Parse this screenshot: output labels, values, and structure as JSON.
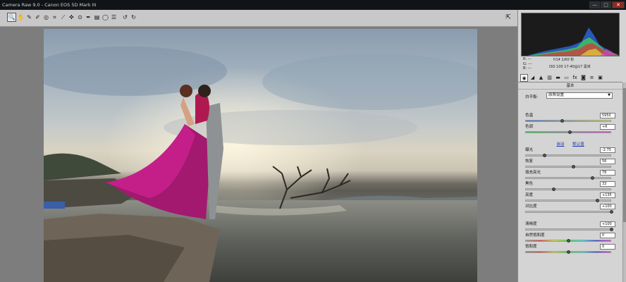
{
  "window": {
    "title": "Camera Raw 9.0 - Canon EOS 5D Mark III",
    "minimize": "—",
    "maximize": "□",
    "close": "✕"
  },
  "toolbar": {
    "tools": [
      {
        "icon": "zoom-tool-icon",
        "glyph": "🔍"
      },
      {
        "icon": "hand-tool-icon",
        "glyph": "✋"
      },
      {
        "icon": "white-balance-tool-icon",
        "glyph": "✎"
      },
      {
        "icon": "color-sampler-tool-icon",
        "glyph": "✐"
      },
      {
        "icon": "targeted-adjustment-tool-icon",
        "glyph": "◎"
      },
      {
        "icon": "crop-tool-icon",
        "glyph": "⌗"
      },
      {
        "icon": "straighten-tool-icon",
        "glyph": "⟋"
      },
      {
        "icon": "spot-removal-tool-icon",
        "glyph": "✜"
      },
      {
        "icon": "red-eye-tool-icon",
        "glyph": "⊙"
      },
      {
        "icon": "adjustment-brush-icon",
        "glyph": "✒"
      },
      {
        "icon": "graduated-filter-icon",
        "glyph": "▤"
      },
      {
        "icon": "radial-filter-icon",
        "glyph": "◯"
      },
      {
        "icon": "preferences-icon",
        "glyph": "☰"
      },
      {
        "icon": "rotate-left-icon",
        "glyph": "↺"
      },
      {
        "icon": "rotate-right-icon",
        "glyph": "↻"
      }
    ],
    "fullscreen_glyph": "⇱"
  },
  "histogram": {
    "rgb": [
      "R: ---",
      "G: ---",
      "B: ---"
    ],
    "aperture_shutter": "f/14   1/60 秒",
    "iso_lens": "ISO 100   17-40@17 毫米",
    "colors": {
      "red": "#e0303a",
      "green": "#46d24b",
      "blue": "#2f6cf0",
      "yellow": "#f0e83a",
      "cyan": "#33d4e8",
      "magenta": "#d03fd6"
    }
  },
  "panel": {
    "tabs": [
      {
        "icon": "basic-tab-icon",
        "glyph": "◉"
      },
      {
        "icon": "tone-curve-tab-icon",
        "glyph": "◢"
      },
      {
        "icon": "detail-tab-icon",
        "glyph": "▲"
      },
      {
        "icon": "hsl-tab-icon",
        "glyph": "▥"
      },
      {
        "icon": "split-toning-tab-icon",
        "glyph": "▬"
      },
      {
        "icon": "lens-corrections-tab-icon",
        "glyph": "▭"
      },
      {
        "icon": "effects-tab-icon",
        "glyph": "fx"
      },
      {
        "icon": "camera-calibration-tab-icon",
        "glyph": "◙"
      },
      {
        "icon": "presets-tab-icon",
        "glyph": "≡"
      },
      {
        "icon": "snapshots-tab-icon",
        "glyph": "▣"
      }
    ],
    "section_title": "基本",
    "white_balance": {
      "label": "白平衡:",
      "value": "原照设置"
    },
    "auto_link": "自动",
    "default_link": "默认值",
    "sliders": [
      {
        "label": "色温",
        "value": "5950",
        "position": 0.43,
        "track": "temp"
      },
      {
        "label": "色调",
        "value": "+6",
        "position": 0.52,
        "track": "tint"
      },
      {
        "label": "曝光",
        "value": "-2.75",
        "position": 0.22,
        "track": "plain"
      },
      {
        "label": "恢复",
        "value": "56",
        "position": 0.56,
        "track": "plain"
      },
      {
        "label": "填充亮光",
        "value": "78",
        "position": 0.78,
        "track": "plain"
      },
      {
        "label": "黑色",
        "value": "33",
        "position": 0.33,
        "track": "plain"
      },
      {
        "label": "亮度",
        "value": "+135",
        "position": 0.84,
        "track": "plain"
      },
      {
        "label": "对比度",
        "value": "+100",
        "position": 1.0,
        "track": "plain"
      },
      {
        "label": "清晰度",
        "value": "+100",
        "position": 1.0,
        "track": "plain"
      },
      {
        "label": "自然饱和度",
        "value": "0",
        "position": 0.5,
        "track": "vibrance"
      },
      {
        "label": "饱和度",
        "value": "0",
        "position": 0.5,
        "track": "saturation"
      }
    ]
  }
}
